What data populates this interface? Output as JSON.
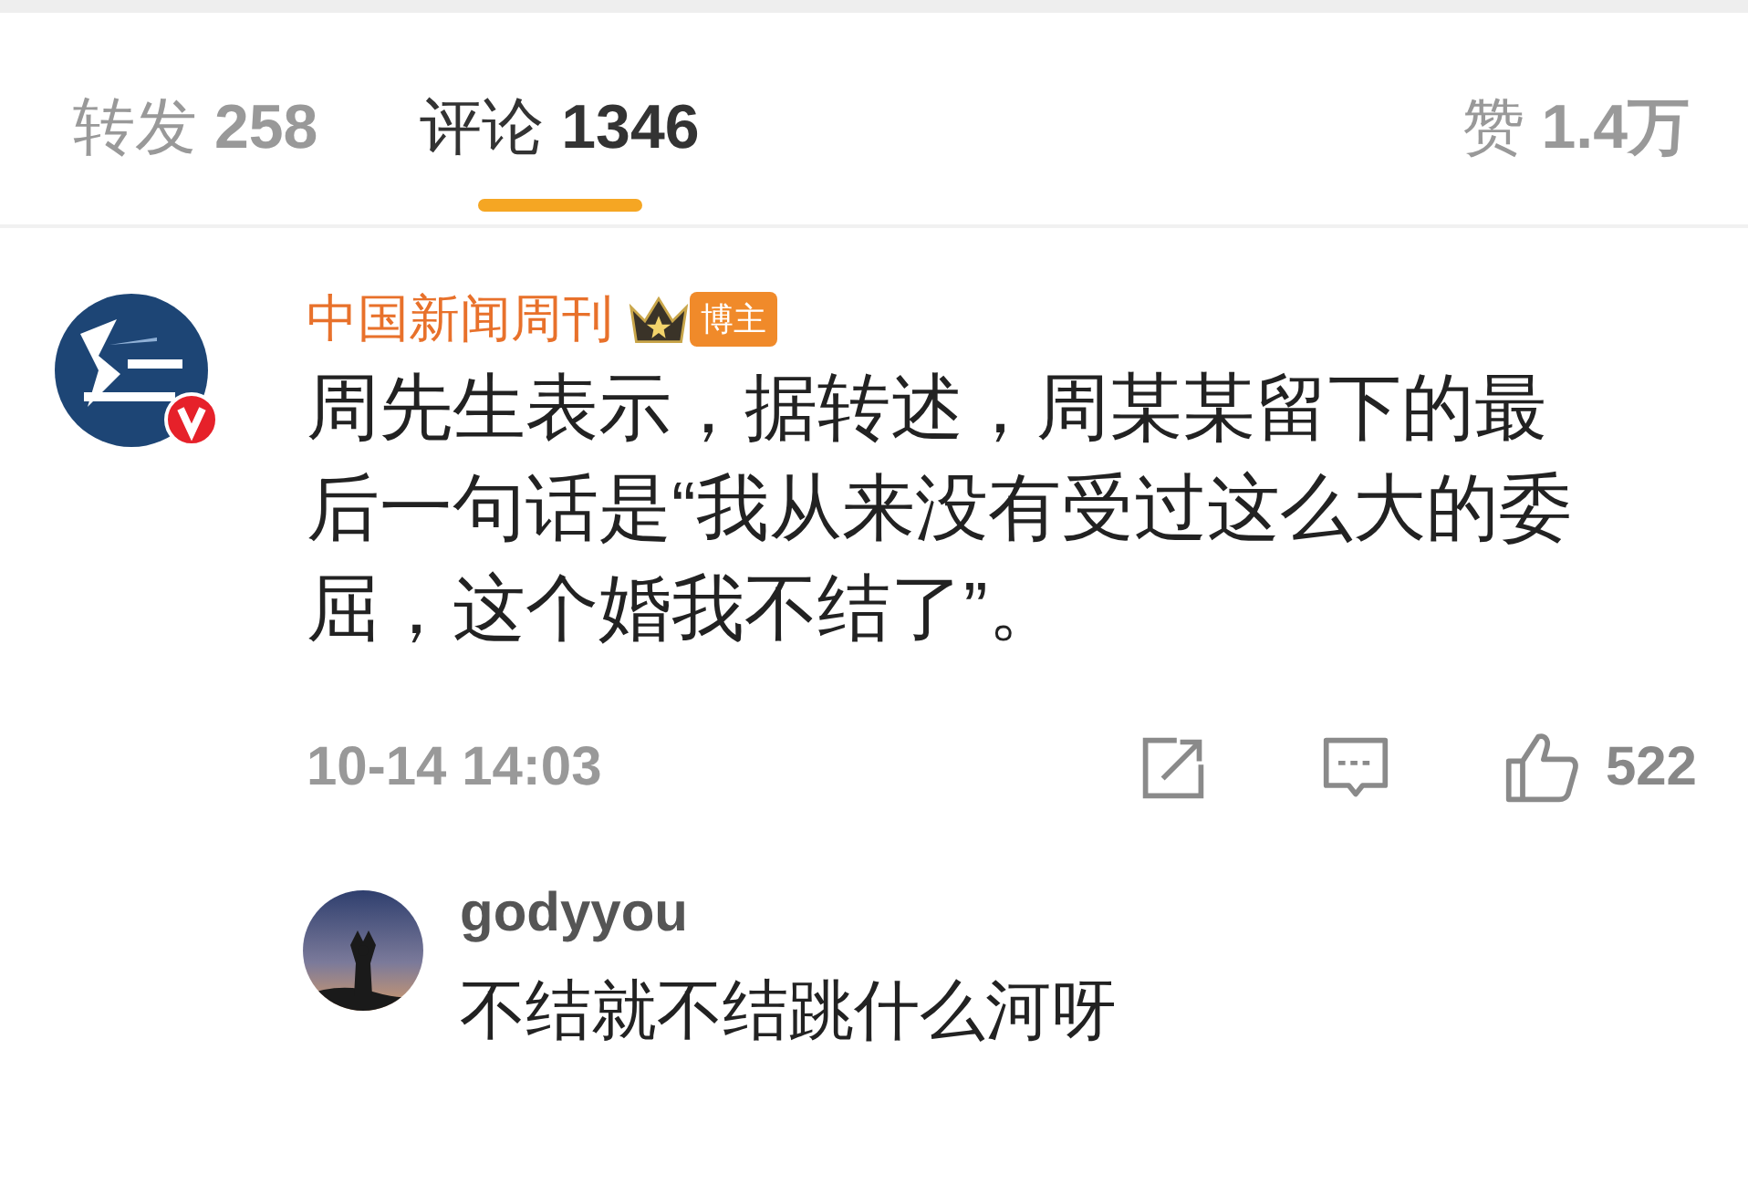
{
  "tabs": [
    {
      "label": "转发",
      "count": "258",
      "selected": false
    },
    {
      "label": "评论",
      "count": "1346",
      "selected": true
    },
    {
      "label": "赞",
      "count": "1.4万",
      "selected": false
    }
  ],
  "comment": {
    "author": "中国新闻周刊",
    "verified": true,
    "badge": "博主",
    "text": "周先生表示，据转述，周某某留下的最后一句话是“我从来没有受过这么大的委屈，这个婚我不结了”。",
    "time": "10-14 14:03",
    "likes": "522",
    "reply": {
      "author": "godyyou",
      "text": "不结就不结跳什么河呀"
    }
  }
}
